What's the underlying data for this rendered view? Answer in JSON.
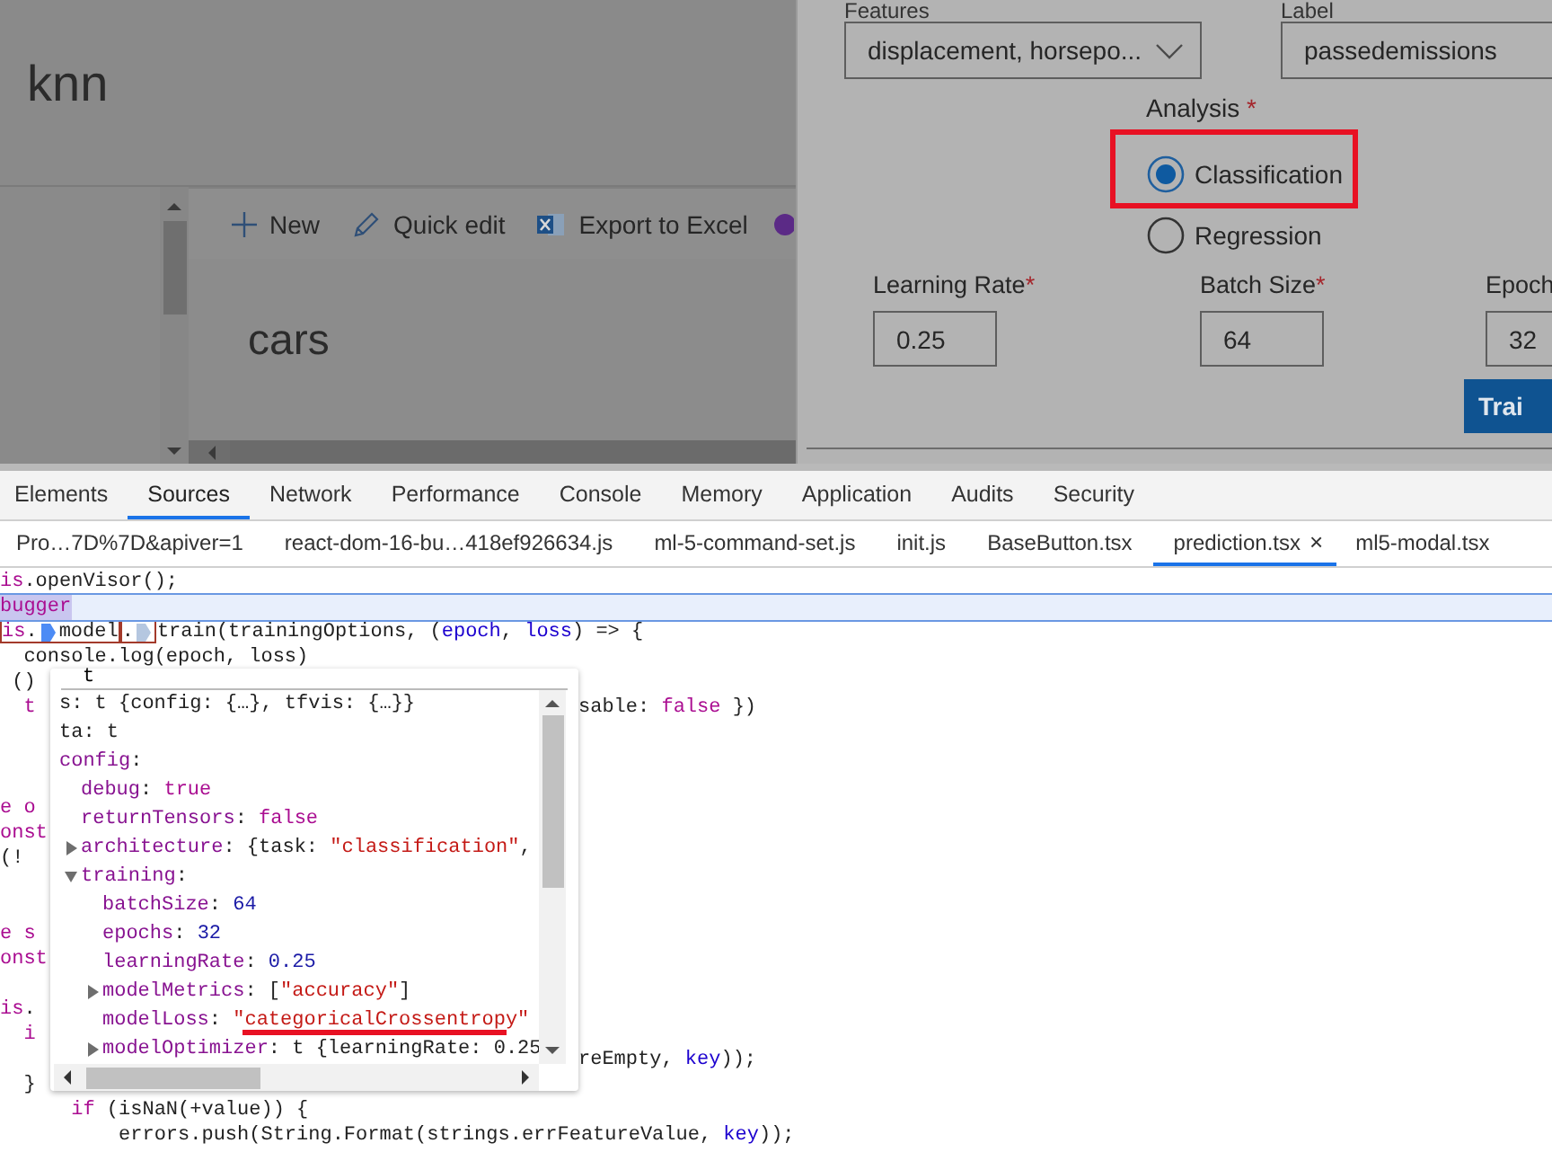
{
  "app_header": {
    "title": "knn"
  },
  "toolbar": [
    {
      "kind": "new",
      "label": "New"
    },
    {
      "kind": "edit",
      "label": "Quick edit"
    },
    {
      "kind": "excel",
      "label": "Export to Excel"
    },
    {
      "kind": "circle"
    }
  ],
  "list_title": "cars",
  "panel": {
    "features_field": {
      "label": "Features",
      "value": "displacement, horsepo..."
    },
    "label_field": {
      "label": "Label",
      "value": "passedemissions"
    },
    "analysis": {
      "label": "Analysis",
      "required_mark": "*",
      "options": [
        {
          "label": "Classification",
          "selected": true
        },
        {
          "label": "Regression",
          "selected": false
        }
      ]
    },
    "params": [
      {
        "label": "Learning Rate",
        "required_mark": "*",
        "value": "0.25"
      },
      {
        "label": "Batch Size",
        "required_mark": "*",
        "value": "64"
      },
      {
        "label": "Epoch",
        "value": "32"
      }
    ],
    "train_button": "Trai"
  },
  "devtools": {
    "tabs": [
      {
        "label": "Elements",
        "selected": false
      },
      {
        "label": "Sources",
        "selected": true
      },
      {
        "label": "Network",
        "selected": false
      },
      {
        "label": "Performance",
        "selected": false
      },
      {
        "label": "Console",
        "selected": false
      },
      {
        "label": "Memory",
        "selected": false
      },
      {
        "label": "Application",
        "selected": false
      },
      {
        "label": "Audits",
        "selected": false
      },
      {
        "label": "Security",
        "selected": false
      }
    ],
    "file_tabs": [
      {
        "label": "Pro…7D%7D&apiver=1",
        "selected": false
      },
      {
        "label": "react-dom-16-bu…418ef926634.js",
        "selected": false
      },
      {
        "label": "ml-5-command-set.js",
        "selected": false
      },
      {
        "label": "init.js",
        "selected": false
      },
      {
        "label": "BaseButton.tsx",
        "selected": false
      },
      {
        "label": "prediction.tsx",
        "selected": true,
        "close": "×"
      },
      {
        "label": "ml5-modal.tsx",
        "selected": false
      }
    ],
    "code_lines": [
      {
        "kind": "code",
        "paused": false,
        "parts": [
          {
            "kind": "keyword",
            "text": "is"
          },
          {
            "kind": "plain",
            "text": ".openVisor();"
          }
        ]
      },
      {
        "kind": "code",
        "paused": true,
        "parts": [
          {
            "kind": "keyword",
            "text": "bugger"
          }
        ]
      },
      {
        "kind": "code",
        "paused": false,
        "parts": [
          {
            "kind": "frame",
            "parts": [
              {
                "kind": "keyword",
                "text": "is"
              },
              {
                "kind": "plain",
                "text": "."
              },
              {
                "kind": "marker",
                "active": true
              },
              {
                "kind": "plain",
                "text": "model"
              }
            ]
          },
          {
            "kind": "frame",
            "parts": [
              {
                "kind": "plain",
                "text": "."
              },
              {
                "kind": "marker",
                "active": false
              }
            ]
          },
          {
            "kind": "plain",
            "text": "train(trainingOptions, ("
          },
          {
            "kind": "variable",
            "text": "epoch"
          },
          {
            "kind": "plain",
            "text": ", "
          },
          {
            "kind": "variable",
            "text": "loss"
          },
          {
            "kind": "plain",
            "text": ") => {"
          }
        ]
      },
      {
        "kind": "code",
        "paused": false,
        "parts": [
          {
            "kind": "plain",
            "text": "  console.log(epoch, loss)"
          }
        ]
      },
      {
        "kind": "code",
        "paused": false,
        "parts": [
          {
            "kind": "plain",
            "text": " ()"
          }
        ]
      },
      {
        "kind": "code",
        "paused": false,
        "parts": [
          {
            "kind": "keyword",
            "text": "  t"
          }
        ],
        "after_popup": [
          {
            "kind": "plain",
            "text": "sable: "
          },
          {
            "kind": "keyword",
            "text": "false"
          },
          {
            "kind": "plain",
            "text": " })"
          }
        ]
      },
      {
        "kind": "blank"
      },
      {
        "kind": "blank"
      },
      {
        "kind": "blank"
      },
      {
        "kind": "code",
        "paused": false,
        "parts": [
          {
            "kind": "keyword",
            "text": "e o"
          }
        ]
      },
      {
        "kind": "code",
        "paused": false,
        "parts": [
          {
            "kind": "keyword",
            "text": "onst"
          }
        ]
      },
      {
        "kind": "code",
        "paused": false,
        "parts": [
          {
            "kind": "plain",
            "text": "(!"
          }
        ]
      },
      {
        "kind": "blank"
      },
      {
        "kind": "blank"
      },
      {
        "kind": "code",
        "paused": false,
        "parts": [
          {
            "kind": "keyword",
            "text": "e s"
          }
        ]
      },
      {
        "kind": "code",
        "paused": false,
        "parts": [
          {
            "kind": "keyword",
            "text": "onst"
          }
        ]
      },
      {
        "kind": "blank"
      },
      {
        "kind": "code",
        "paused": false,
        "parts": [
          {
            "kind": "keyword",
            "text": "is"
          },
          {
            "kind": "plain",
            "text": "."
          }
        ]
      },
      {
        "kind": "code",
        "paused": false,
        "parts": [
          {
            "kind": "keyword",
            "text": "  i"
          }
        ]
      },
      {
        "kind": "code",
        "paused": false,
        "after_popup": [
          {
            "kind": "plain",
            "text": "reEmpty, "
          },
          {
            "kind": "variable",
            "text": "key"
          },
          {
            "kind": "plain",
            "text": "));"
          }
        ]
      },
      {
        "kind": "code",
        "paused": false,
        "parts": [
          {
            "kind": "plain",
            "text": "  }"
          }
        ]
      },
      {
        "kind": "code",
        "paused": false,
        "parts": [
          {
            "kind": "keyword",
            "text": "      if"
          },
          {
            "kind": "plain",
            "text": " (isNaN(+value)) {"
          }
        ]
      },
      {
        "kind": "code",
        "paused": false,
        "parts": [
          {
            "kind": "plain",
            "text": "          errors.push(String.Format(strings.errFeatureValue, "
          },
          {
            "kind": "variable",
            "text": "key"
          },
          {
            "kind": "plain",
            "text": "));"
          }
        ]
      }
    ],
    "popup": {
      "title": "t",
      "nodes": [
        {
          "parts": [
            {
              "kind": "plain",
              "text": "s: t {config: {…}, tfvis: {…}}"
            }
          ]
        },
        {
          "parts": [
            {
              "kind": "plain",
              "text": "ta: t"
            }
          ]
        },
        {
          "parts": [
            {
              "kind": "key",
              "text": "config"
            },
            {
              "kind": "plain",
              "text": ":"
            }
          ],
          "children": [
            {
              "parts": [
                {
                  "kind": "key",
                  "text": "debug"
                },
                {
                  "kind": "plain",
                  "text": ": "
                },
                {
                  "kind": "keyword",
                  "text": "true"
                }
              ]
            },
            {
              "parts": [
                {
                  "kind": "key",
                  "text": "returnTensors"
                },
                {
                  "kind": "plain",
                  "text": ": "
                },
                {
                  "kind": "keyword",
                  "text": "false"
                }
              ]
            },
            {
              "expanded": false,
              "parts": [
                {
                  "kind": "key",
                  "text": "architecture"
                },
                {
                  "kind": "plain",
                  "text": ": {task: "
                },
                {
                  "kind": "string",
                  "text": "\"classification\""
                },
                {
                  "kind": "plain",
                  "text": ","
                }
              ]
            },
            {
              "expanded": true,
              "parts": [
                {
                  "kind": "key",
                  "text": "training"
                },
                {
                  "kind": "plain",
                  "text": ":"
                }
              ],
              "children": [
                {
                  "parts": [
                    {
                      "kind": "key",
                      "text": "batchSize"
                    },
                    {
                      "kind": "plain",
                      "text": ": "
                    },
                    {
                      "kind": "number",
                      "text": "64"
                    }
                  ]
                },
                {
                  "parts": [
                    {
                      "kind": "key",
                      "text": "epochs"
                    },
                    {
                      "kind": "plain",
                      "text": ": "
                    },
                    {
                      "kind": "number",
                      "text": "32"
                    }
                  ]
                },
                {
                  "parts": [
                    {
                      "kind": "key",
                      "text": "learningRate"
                    },
                    {
                      "kind": "plain",
                      "text": ": "
                    },
                    {
                      "kind": "number",
                      "text": "0.25"
                    }
                  ]
                },
                {
                  "expanded": false,
                  "parts": [
                    {
                      "kind": "key",
                      "text": "modelMetrics"
                    },
                    {
                      "kind": "plain",
                      "text": ": ["
                    },
                    {
                      "kind": "string",
                      "text": "\"accuracy\""
                    },
                    {
                      "kind": "plain",
                      "text": "]"
                    }
                  ]
                },
                {
                  "parts": [
                    {
                      "kind": "key",
                      "text": "modelLoss"
                    },
                    {
                      "kind": "plain",
                      "text": ": "
                    },
                    {
                      "kind": "string",
                      "text": "\"categoricalCrossentropy\""
                    }
                  ]
                },
                {
                  "expanded": false,
                  "parts": [
                    {
                      "kind": "key",
                      "text": "modelOptimizer"
                    },
                    {
                      "kind": "plain",
                      "text": ": t {learningRate: 0.25"
                    }
                  ]
                }
              ]
            }
          ]
        }
      ]
    }
  }
}
